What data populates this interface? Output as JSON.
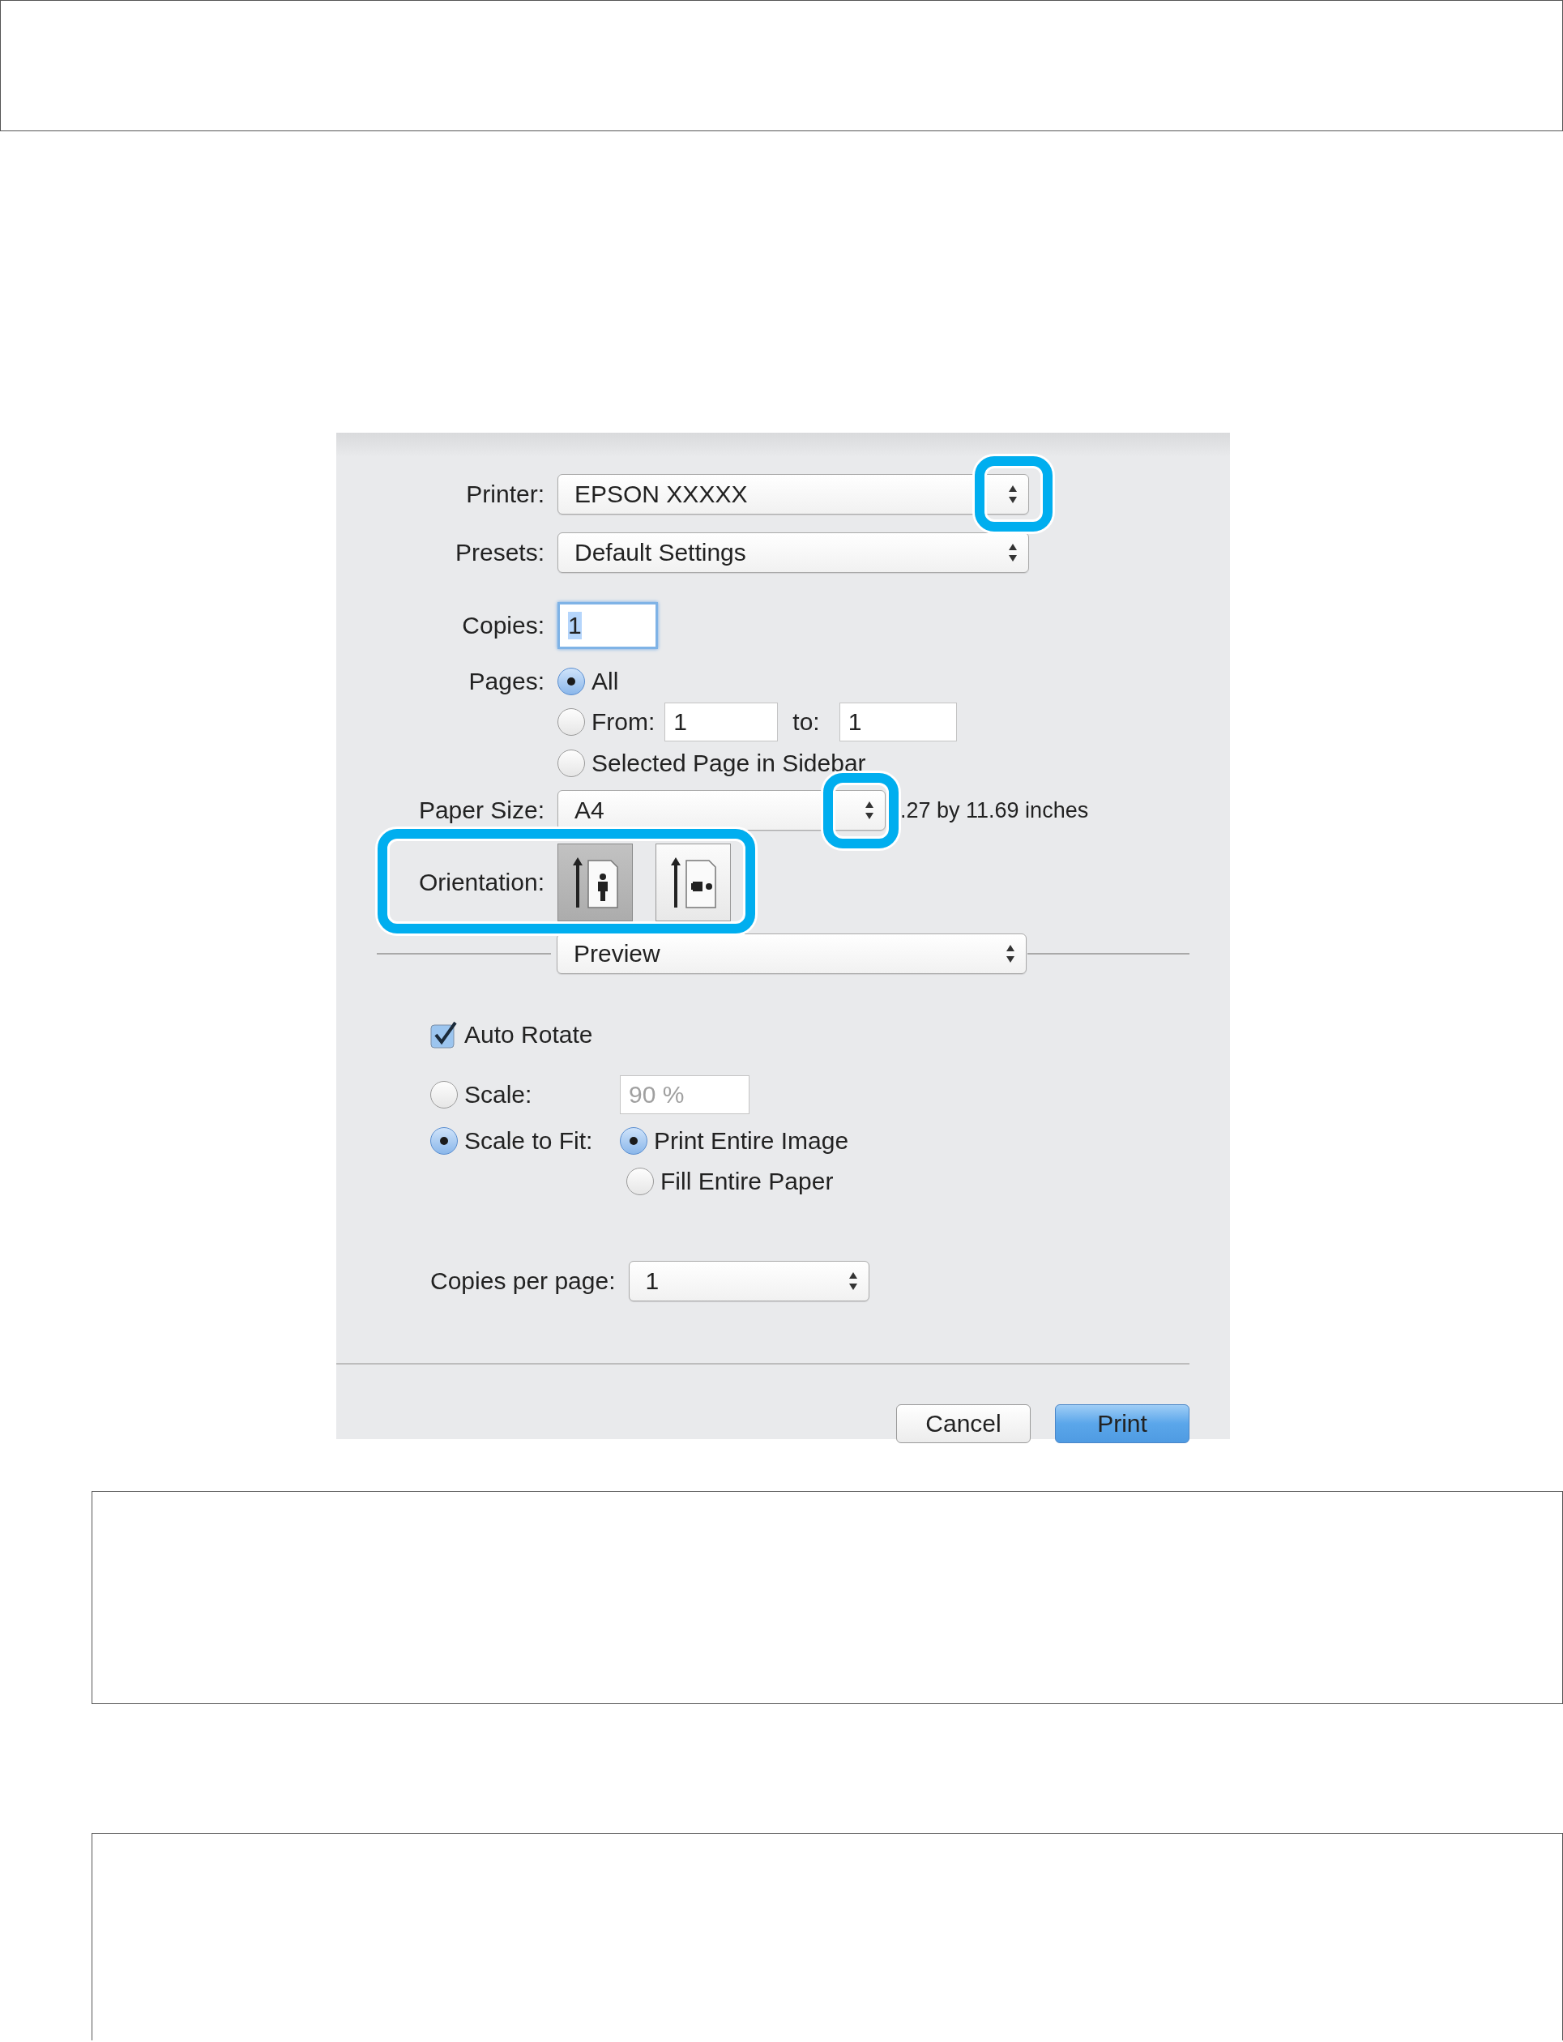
{
  "dialog": {
    "printer": {
      "label": "Printer:",
      "value": "EPSON XXXXX"
    },
    "presets": {
      "label": "Presets:",
      "value": "Default Settings"
    },
    "copies": {
      "label": "Copies:",
      "value": "1"
    },
    "pages": {
      "label": "Pages:",
      "options": [
        {
          "kind": "all",
          "label": "All",
          "selected": true
        },
        {
          "kind": "range",
          "label": "From:",
          "selected": false,
          "from": "1",
          "to_label": "to:",
          "to": "1"
        },
        {
          "kind": "plain",
          "label": "Selected Page in Sidebar",
          "selected": false
        }
      ]
    },
    "paper_size": {
      "label": "Paper Size:",
      "value": "A4",
      "note": ".27 by 11.69 inches"
    },
    "orientation": {
      "label": "Orientation:",
      "options": [
        {
          "kind": "portrait",
          "selected": true
        },
        {
          "kind": "landscape",
          "selected": false
        }
      ]
    },
    "section": {
      "value": "Preview"
    },
    "auto_rotate": {
      "label": "Auto Rotate",
      "checked": true
    },
    "scale": {
      "label": "Scale:",
      "selected": false,
      "value": "90 %",
      "disabled": true
    },
    "scale_to_fit": {
      "label": "Scale to Fit:",
      "selected": true,
      "options": [
        {
          "label": "Print Entire Image",
          "selected": true
        },
        {
          "label": "Fill Entire Paper",
          "selected": false
        }
      ]
    },
    "copies_per_page": {
      "label": "Copies per page:",
      "value": "1"
    },
    "buttons": [
      {
        "label": "Cancel",
        "default": false
      },
      {
        "label": "Print",
        "default": true
      }
    ]
  }
}
